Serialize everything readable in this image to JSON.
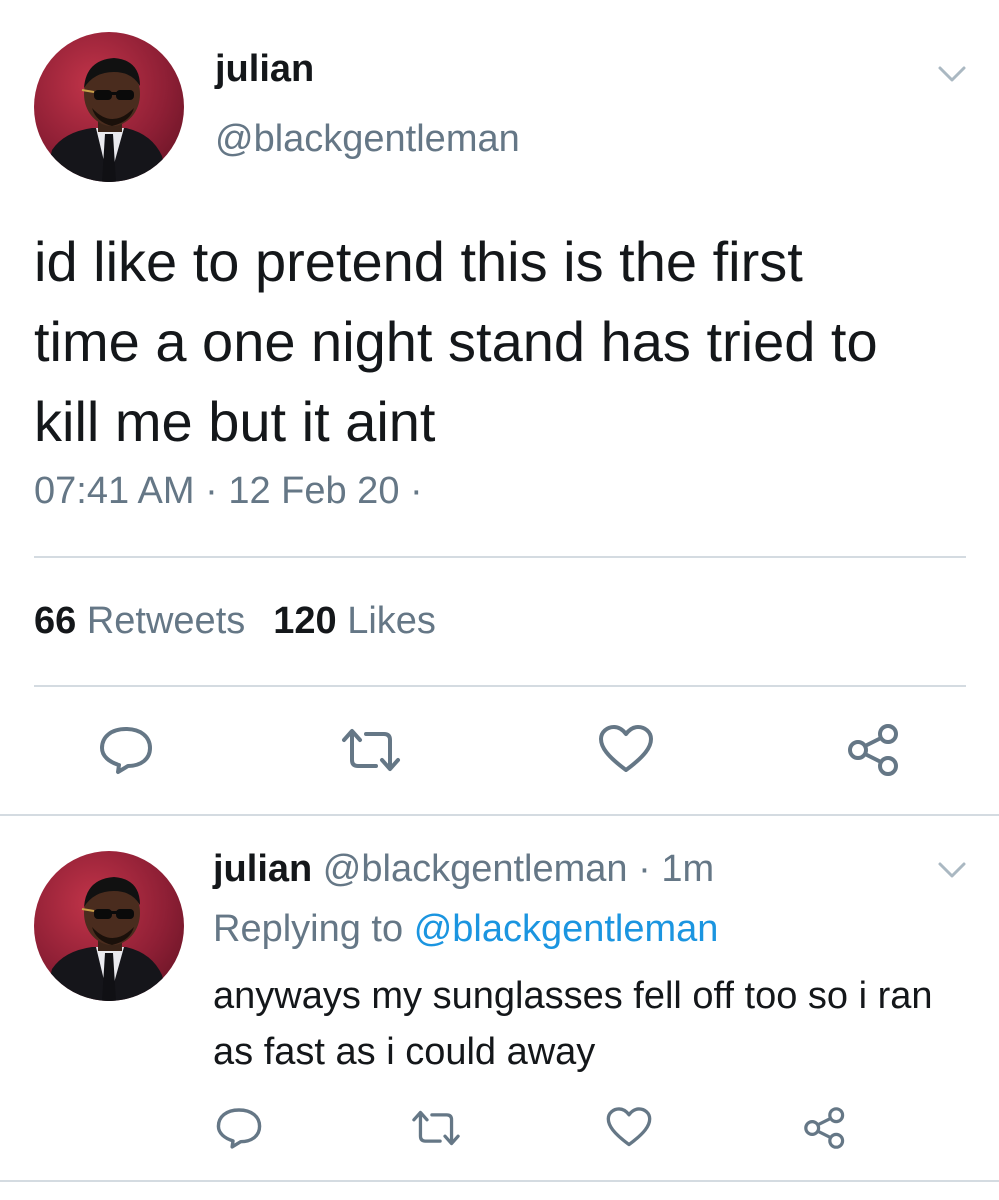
{
  "tweet": {
    "display_name": "julian",
    "handle": "@blackgentleman",
    "text": "id like to pretend this is the first\ntime a one night stand has tried to\nkill me but it aint",
    "timestamp": "07:41 AM · 12 Feb 20 ·",
    "retweets_count": "66",
    "retweets_label": "Retweets",
    "likes_count": "120",
    "likes_label": "Likes"
  },
  "reply": {
    "display_name": "julian",
    "handle": "@blackgentleman",
    "separator": "·",
    "time_ago": "1m",
    "replying_prefix": "Replying to",
    "replying_to": "@blackgentleman",
    "text": "anyways my sunglasses fell off too so i ran as fast as i could away"
  },
  "icons": {
    "avatar": "profile-photo",
    "chevron": "chevron-down-icon",
    "reply": "reply-bubble-icon",
    "retweet": "retweet-arrows-icon",
    "like": "heart-icon",
    "share": "share-nodes-icon"
  },
  "colors": {
    "text": "#14171a",
    "secondary": "#657786",
    "link": "#1b95e0",
    "divider": "#d4dbe1",
    "icon": "#657786"
  }
}
